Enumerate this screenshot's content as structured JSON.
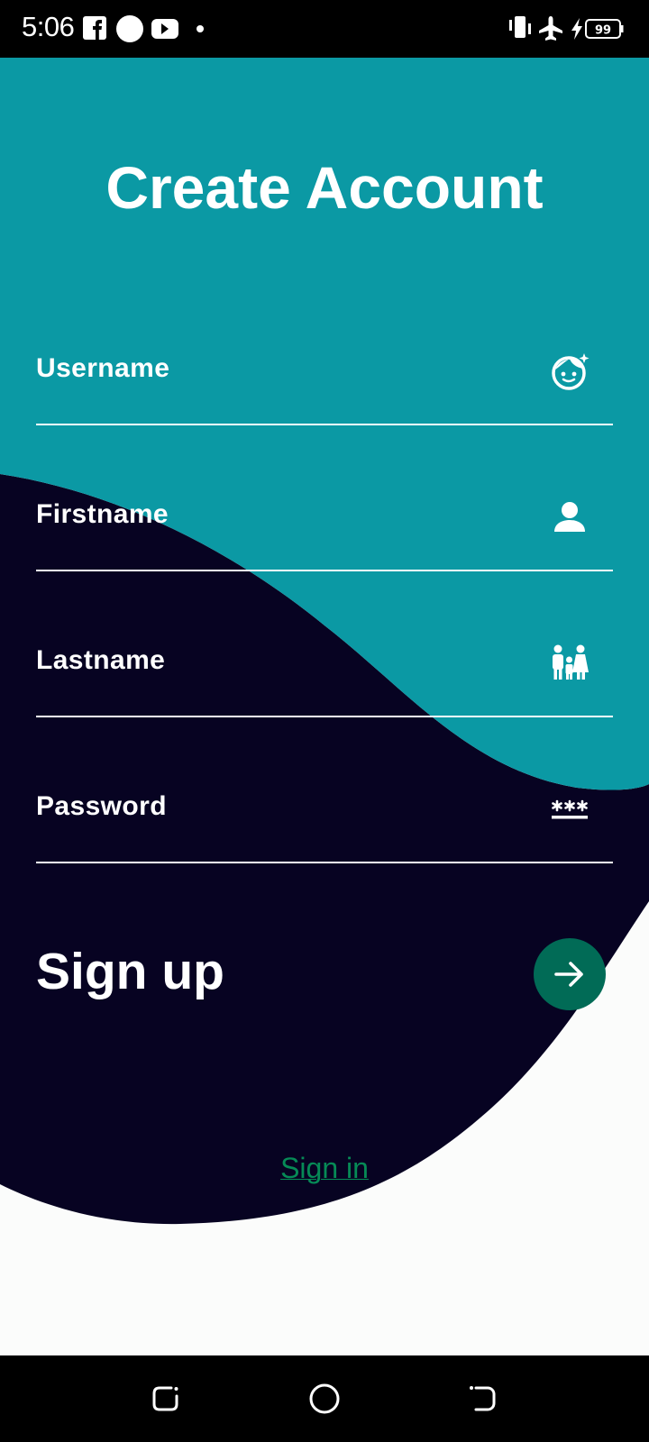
{
  "status_bar": {
    "time": "5:06",
    "battery_level": "99",
    "left_icons": [
      "facebook-icon",
      "circle-notification-icon",
      "youtube-icon",
      "dot-icon"
    ],
    "right_icons": [
      "vibrate-icon",
      "airplane-mode-icon",
      "charging-icon",
      "battery-icon"
    ]
  },
  "page": {
    "title": "Create Account"
  },
  "form": {
    "fields": [
      {
        "label": "Username",
        "icon": "face-sparkle-icon"
      },
      {
        "label": "Firstname",
        "icon": "person-icon"
      },
      {
        "label": "Lastname",
        "icon": "family-icon"
      },
      {
        "label": "Password",
        "icon": "password-icon"
      }
    ],
    "submit_label": "Sign up",
    "submit_icon": "arrow-right-icon",
    "signin_link": "Sign in"
  },
  "colors": {
    "teal": "#0b99a4",
    "dark_navy": "#070322",
    "button_green": "#016b56",
    "link_green": "#068a56",
    "background": "#fbfcfb"
  },
  "nav_bar": {
    "buttons": [
      "recent-apps-icon",
      "home-icon",
      "back-icon"
    ]
  }
}
